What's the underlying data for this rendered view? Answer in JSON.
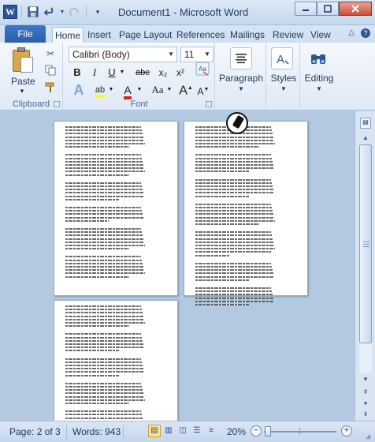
{
  "window": {
    "title": "Document1  -  Microsoft Word",
    "app_logo": "W",
    "controls": [
      "minimize-icon",
      "maximize-icon",
      "close-icon"
    ]
  },
  "qat": {
    "items": [
      "save-icon",
      "undo-icon",
      "redo-icon",
      "customize-icon"
    ]
  },
  "tabs": {
    "file": "File",
    "items": [
      "Home",
      "Insert",
      "Page Layout",
      "References",
      "Mailings",
      "Review",
      "View"
    ],
    "active": "Home"
  },
  "clipboard": {
    "paste": "Paste",
    "label": "Clipboard"
  },
  "font": {
    "name": "Calibri (Body)",
    "size": "11",
    "bold": "B",
    "italic": "I",
    "underline": "U",
    "strike": "abc",
    "subscript": "x₂",
    "superscript": "x²",
    "grow": "A",
    "shrink": "A",
    "case": "Aa",
    "highlight": "ab",
    "font_color": "A",
    "label": "Font"
  },
  "paragraph": {
    "label": "Paragraph"
  },
  "styles": {
    "label": "Styles"
  },
  "editing": {
    "label": "Editing"
  },
  "statusbar": {
    "page": "Page: 2 of 3",
    "words": "Words: 943",
    "zoom": "20%",
    "zoom_level": 0.2
  },
  "colors": {
    "accent": "#2b5797",
    "ribbon": "#dfe9f5",
    "workspace": "#b3c9e0"
  }
}
